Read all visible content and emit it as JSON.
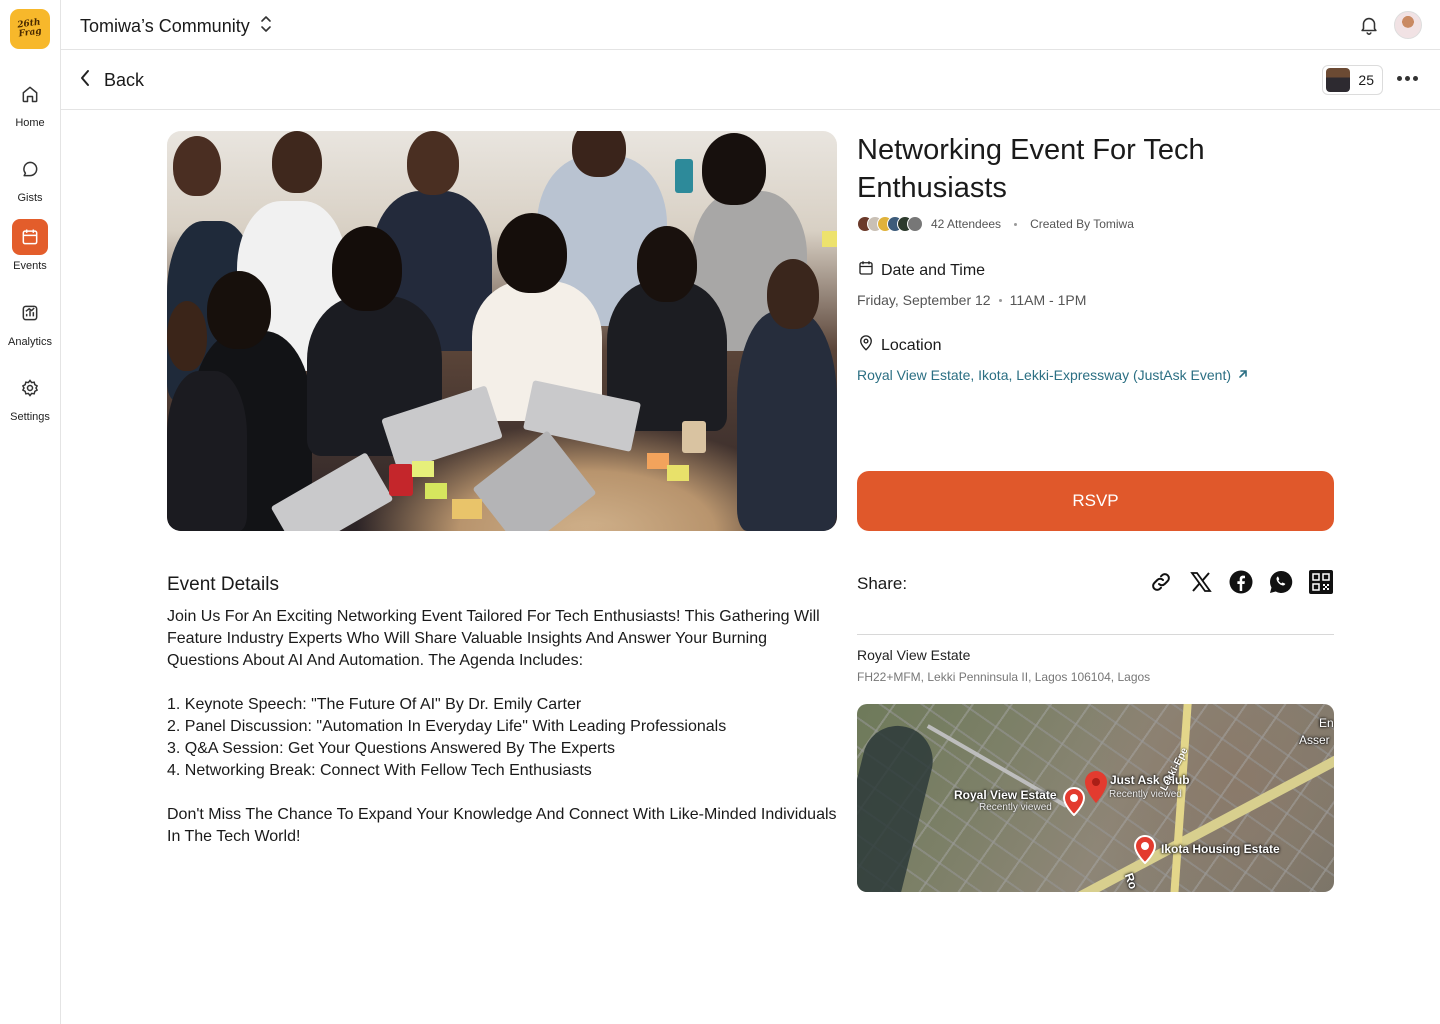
{
  "app": {
    "logo_text_line1": "26th",
    "logo_text_line2": "Frag"
  },
  "sidebar": {
    "items": [
      {
        "label": "Home",
        "icon": "home-icon",
        "active": false
      },
      {
        "label": "Gists",
        "icon": "chat-icon",
        "active": false
      },
      {
        "label": "Events",
        "icon": "calendar-icon",
        "active": true
      },
      {
        "label": "Analytics",
        "icon": "analytics-icon",
        "active": false
      },
      {
        "label": "Settings",
        "icon": "gear-icon",
        "active": false
      }
    ],
    "accent_color": "#e35d2b"
  },
  "topbar": {
    "community_name": "Tomiwa’s Community"
  },
  "subbar": {
    "back_label": "Back",
    "participant_count": "25"
  },
  "event": {
    "title": "Networking Event For Tech Enthusiasts",
    "attendees": "42 Attendees",
    "created_by": "Created By Tomiwa",
    "date_heading": "Date and Time",
    "date": "Friday, September 12",
    "time": "11AM - 1PM",
    "location_heading": "Location",
    "location_link": "Royal View Estate, Ikota, Lekki-Expressway (JustAsk Event)",
    "rsvp_label": "RSVP",
    "rsvp_color": "#e0582b"
  },
  "details": {
    "title": "Event Details",
    "intro": "Join Us For An Exciting Networking Event Tailored For Tech Enthusiasts! This Gathering Will Feature Industry Experts Who Will Share Valuable Insights And Answer Your Burning Questions About AI And Automation. The Agenda Includes:",
    "agenda": [
      "1. Keynote Speech: \"The Future Of AI\" By Dr. Emily Carter",
      "2. Panel Discussion: \"Automation In Everyday Life\" With Leading Professionals",
      "3. Q&A Session: Get Your Questions Answered By The Experts",
      "4. Networking Break: Connect With Fellow Tech Enthusiasts"
    ],
    "closing": "Don't Miss The Chance To Expand Your Knowledge And Connect With Like-Minded Individuals In The Tech World!"
  },
  "share": {
    "label": "Share:",
    "icons": [
      "link-icon",
      "x-icon",
      "facebook-icon",
      "whatsapp-icon",
      "qr-code-icon"
    ]
  },
  "place": {
    "name": "Royal View Estate",
    "address": "FH22+MFM, Lekki Penninsula II, Lagos 106104, Lagos"
  },
  "map": {
    "labels": [
      {
        "title": "Royal View Estate",
        "sub": "Recently viewed"
      },
      {
        "title": "Just Ask Club",
        "sub": "Recently viewed"
      },
      {
        "title": "Ikota Housing Estate",
        "sub": ""
      }
    ],
    "road_labels": [
      "Lekki-Epe",
      "Ro"
    ],
    "edge_labels": [
      "En",
      "Asser"
    ]
  }
}
